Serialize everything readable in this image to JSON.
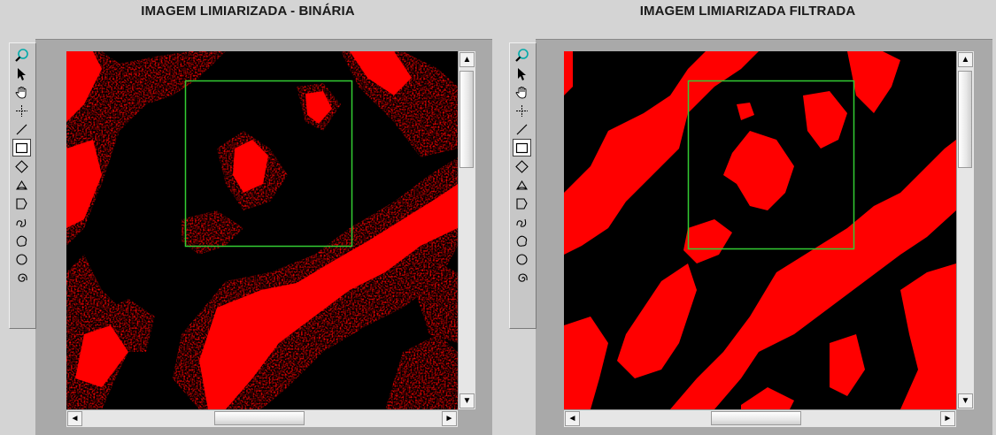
{
  "panels": [
    {
      "title": "IMAGEM LIMIARIZADA - BINÁRIA"
    },
    {
      "title": "IMAGEM LIMIARIZADA FILTRADA"
    }
  ],
  "tools": [
    {
      "name": "zoom-icon",
      "glyph": ""
    },
    {
      "name": "pointer-icon",
      "glyph": ""
    },
    {
      "name": "pan-hand-icon",
      "glyph": ""
    },
    {
      "name": "point-icon",
      "glyph": ""
    },
    {
      "name": "line-icon",
      "glyph": ""
    },
    {
      "name": "rectangle-icon",
      "glyph": ""
    },
    {
      "name": "rotated-rectangle-icon",
      "glyph": ""
    },
    {
      "name": "annulus-icon",
      "glyph": ""
    },
    {
      "name": "polygon-icon",
      "glyph": ""
    },
    {
      "name": "freehand-line-icon",
      "glyph": ""
    },
    {
      "name": "freehand-region-icon",
      "glyph": ""
    },
    {
      "name": "oval-icon",
      "glyph": ""
    },
    {
      "name": "spiral-icon",
      "glyph": ""
    }
  ],
  "selected_tool": "rectangle-icon",
  "colors": {
    "foreground": "#ff0000",
    "background": "#000000",
    "roi": "#33cc33"
  },
  "scroll": {
    "up_arrow": "▲",
    "down_arrow": "▼",
    "left_arrow": "◄",
    "right_arrow": "►"
  }
}
